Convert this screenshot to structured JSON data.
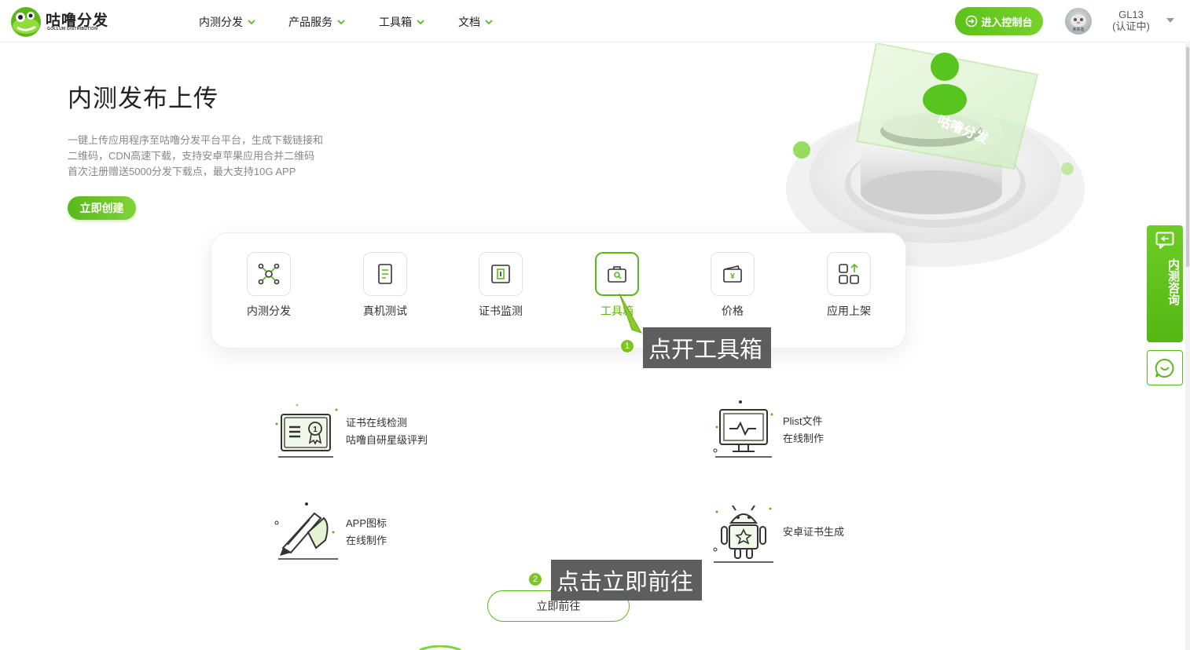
{
  "header": {
    "logo_text": "咕噜分发",
    "logo_sub": "GOLLUM DISTRIBUTION",
    "nav": [
      "内测分发",
      "产品服务",
      "工具箱",
      "文档"
    ],
    "console_label": "进入控制台",
    "avatar_text": "未实名",
    "user_name": "GL13",
    "user_status": "(认证中)"
  },
  "hero": {
    "title": "内测发布上传",
    "desc": [
      "一键上传应用程序至咕噜分发平台平台，生成下载链接和",
      "二维码，CDN高速下载，支持安卓苹果应用合并二维码",
      "首次注册赠送5000分发下载点，最大支持10G APP"
    ],
    "create_label": "立即创建",
    "art_text": "咕噜分发"
  },
  "tools": [
    {
      "label": "内测分发",
      "icon": "network-icon"
    },
    {
      "label": "真机测试",
      "icon": "phone-test-icon"
    },
    {
      "label": "证书监测",
      "icon": "certificate-monitor-icon"
    },
    {
      "label": "工具箱",
      "icon": "toolbox-icon",
      "active": true
    },
    {
      "label": "价格",
      "icon": "wallet-yen-icon"
    },
    {
      "label": "应用上架",
      "icon": "app-upload-icon"
    }
  ],
  "features": [
    {
      "lines": [
        "证书在线检测",
        "咕噜自研星级评判"
      ],
      "icon": "certificate-award-icon"
    },
    {
      "lines": [
        "Plist文件",
        "在线制作"
      ],
      "icon": "monitor-pulse-icon"
    },
    {
      "lines": [
        "APP图标",
        "在线制作"
      ],
      "icon": "pen-brush-icon"
    },
    {
      "lines": [
        "安卓证书生成"
      ],
      "icon": "android-icon"
    }
  ],
  "go_label": "立即前往",
  "side": {
    "consult_label": "内测咨询"
  },
  "annotations": [
    {
      "num": "1",
      "text": "点开工具箱"
    },
    {
      "num": "2",
      "text": "点击立即前往"
    }
  ],
  "colors": {
    "accent": "#5ab81a",
    "annotation_bg": "#505050"
  }
}
